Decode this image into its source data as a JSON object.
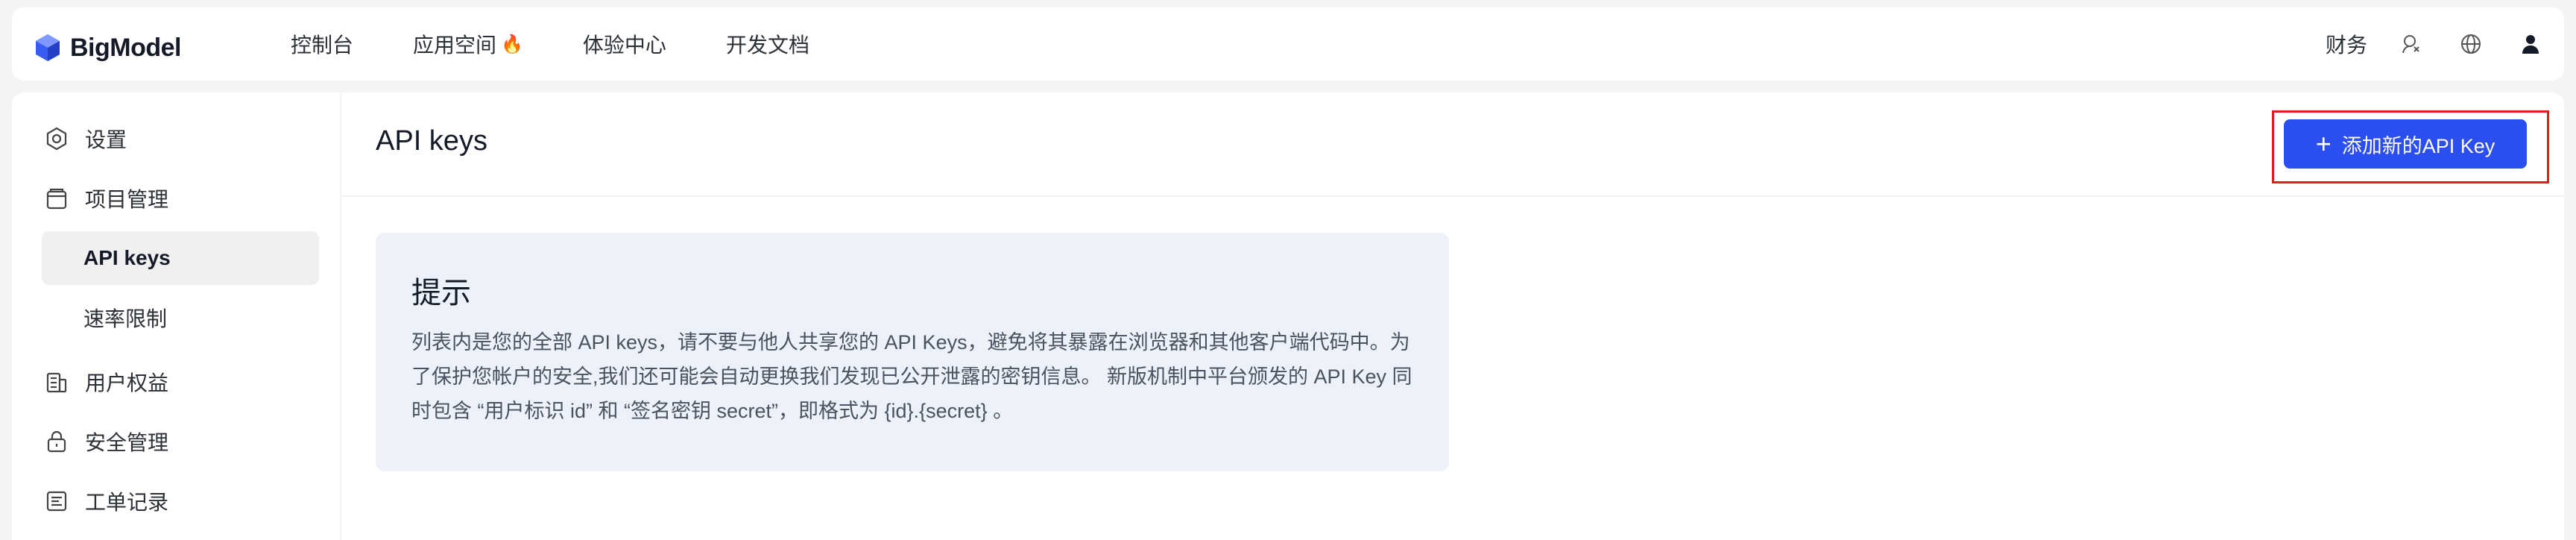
{
  "brand": {
    "name": "BigModel",
    "logo_icon": "hexagon-logo-icon",
    "accent": "#2b4ef0"
  },
  "nav": {
    "items": [
      {
        "label": "控制台"
      },
      {
        "label": "应用空间",
        "badge_icon": "🔥"
      },
      {
        "label": "体验中心"
      },
      {
        "label": "开发文档"
      }
    ]
  },
  "top_right": {
    "finance_label": "财务",
    "icons": [
      "support-agent-icon",
      "globe-icon",
      "user-icon"
    ]
  },
  "sidebar": {
    "items": [
      {
        "label": "设置",
        "icon": "gear-icon"
      },
      {
        "label": "项目管理",
        "icon": "project-icon"
      },
      {
        "label": "API keys",
        "active": true
      },
      {
        "label": "速率限制"
      },
      {
        "label": "用户权益",
        "icon": "benefits-icon"
      },
      {
        "label": "安全管理",
        "icon": "lock-icon"
      },
      {
        "label": "工单记录",
        "icon": "ticket-icon"
      }
    ]
  },
  "main": {
    "title": "API keys",
    "add_button_label": "添加新的API Key",
    "highlight_color": "#e02020",
    "tip": {
      "title": "提示",
      "body": "列表内是您的全部 API keys，请不要与他人共享您的 API Keys，避免将其暴露在浏览器和其他客户端代码中。为了保护您帐户的安全,我们还可能会自动更换我们发现已公开泄露的密钥信息。 新版机制中平台颁发的 API Key 同时包含 “用户标识 id” 和 “签名密钥 secret”，即格式为 {id}.{secret} 。"
    }
  }
}
